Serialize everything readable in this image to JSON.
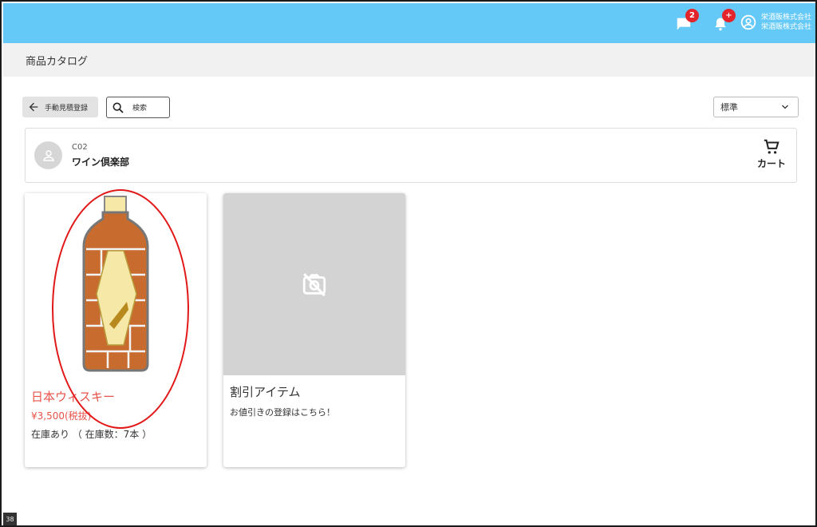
{
  "header": {
    "messages_badge": "2",
    "notifications_badge": "+",
    "account_line1": "栄酒販株式会社",
    "account_line2": "栄酒販株式会社"
  },
  "page": {
    "title": "商品カタログ"
  },
  "toolbar": {
    "back_label": "手動見積登録",
    "search_placeholder": "検索",
    "sort_value": "標準"
  },
  "customer": {
    "code": "C02",
    "name": "ワイン倶楽部",
    "cart_label": "カート"
  },
  "products": [
    {
      "name": "日本ウィスキー",
      "price": "¥3,500(税抜)",
      "stock": "在庫あり （ 在庫数：7本 ）"
    },
    {
      "name": "割引アイテム",
      "description": "お値引きの登録はこちら！"
    }
  ],
  "footer": {
    "corner_tag": "38"
  },
  "colors": {
    "topbar": "#64c9f6",
    "badge": "#e3242b",
    "price_accent": "#e8534a",
    "annotation": "#e21818"
  },
  "icons": [
    "chat-icon",
    "bell-icon",
    "account-circle-icon",
    "arrow-left-icon",
    "search-icon",
    "chevron-down-icon",
    "person-icon",
    "cart-icon",
    "no-image-icon"
  ]
}
